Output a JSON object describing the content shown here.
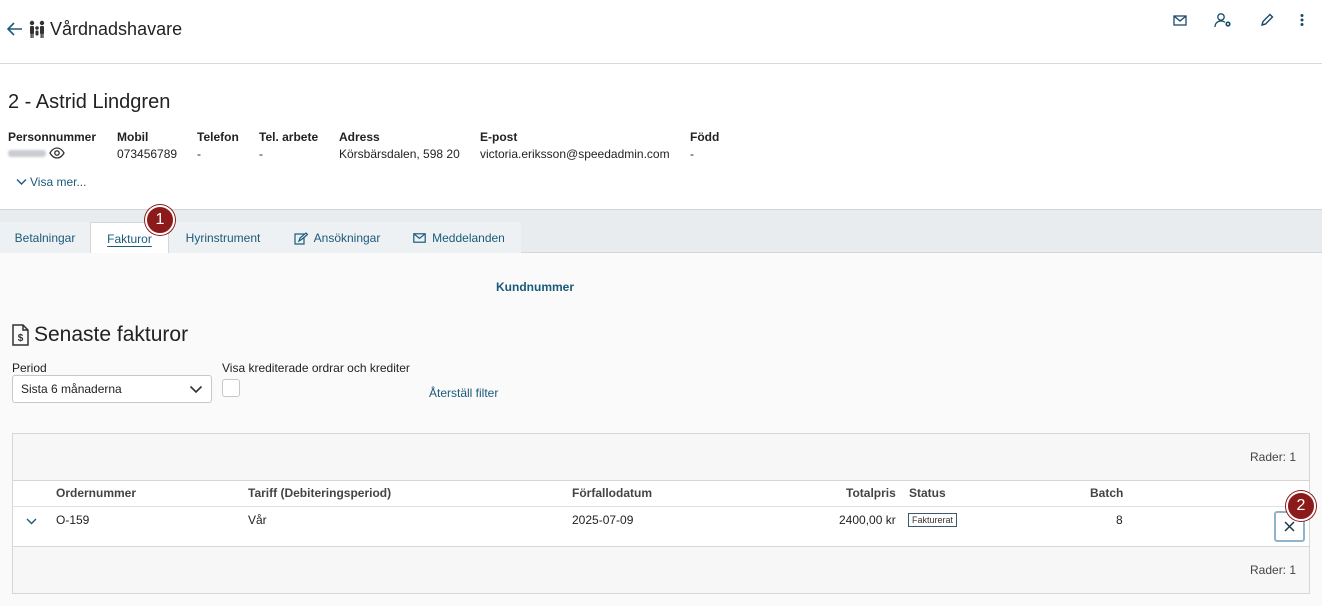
{
  "header": {
    "title": "Vårdnadshavare",
    "icons": [
      "back-arrow-icon",
      "family-icon",
      "mail-icon",
      "user-settings-icon",
      "pencil-icon",
      "more-vertical-icon"
    ]
  },
  "person": {
    "heading": "2  - Astrid Lindgren",
    "fields": [
      {
        "label": "Personnummer",
        "value": ""
      },
      {
        "label": "Mobil",
        "value": "073456789"
      },
      {
        "label": "Telefon",
        "value": "-"
      },
      {
        "label": "Tel. arbete",
        "value": "-"
      },
      {
        "label": "Adress",
        "value": "Körsbärsdalen, 598 20"
      },
      {
        "label": "E-post",
        "value": "victoria.eriksson@speedadmin.com"
      },
      {
        "label": "Född",
        "value": "-"
      }
    ],
    "show_more": "Visa mer..."
  },
  "tabs": [
    {
      "label": "Betalningar",
      "active": false
    },
    {
      "label": "Fakturor",
      "active": true
    },
    {
      "label": "Hyrinstrument",
      "active": false
    },
    {
      "label": "Ansökningar",
      "active": false
    },
    {
      "label": "Meddelanden",
      "active": false
    }
  ],
  "badges": [
    "1",
    "2"
  ],
  "main": {
    "kundnummer": "Kundnummer",
    "section_title": "Senaste fakturor",
    "period_label": "Period",
    "period_value": "Sista 6 månaderna",
    "checkbox_label": "Visa krediterade ordrar och krediter",
    "reset_filter": "Återställ filter",
    "rows_top": "Rader: 1",
    "rows_bottom": "Rader: 1"
  },
  "table": {
    "columns": [
      "Ordernummer",
      "Tariff (Debiteringsperiod)",
      "Förfallodatum",
      "Totalpris",
      "Status",
      "Batch"
    ],
    "rows": [
      {
        "ordernummer": "O-159",
        "tariff": "Vår",
        "forfallodatum": "2025-07-09",
        "totalpris": "2400,00 kr",
        "status": "Fakturerat",
        "batch": "8"
      }
    ]
  },
  "colors": {
    "accent": "#1a5a7a",
    "badge": "#8c1a1a",
    "tabbar": "#e9ecef"
  }
}
